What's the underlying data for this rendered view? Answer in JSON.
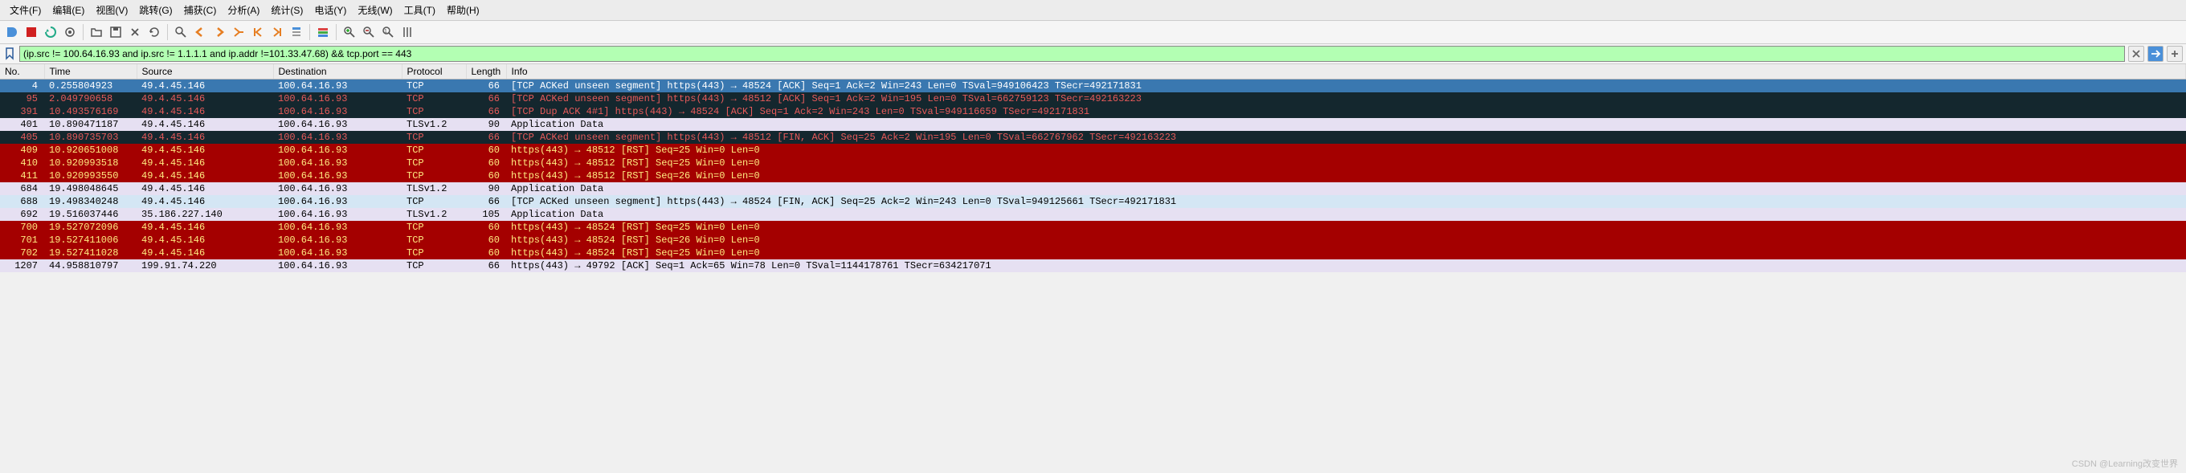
{
  "menu": {
    "file": "文件(F)",
    "edit": "编辑(E)",
    "view": "视图(V)",
    "go": "跳转(G)",
    "capture": "捕获(C)",
    "analyze": "分析(A)",
    "statistics": "统计(S)",
    "telephony": "电话(Y)",
    "wireless": "无线(W)",
    "tools": "工具(T)",
    "help": "帮助(H)"
  },
  "filter": {
    "value": "(ip.src != 100.64.16.93 and ip.src != 1.1.1.1 and ip.addr !=101.33.47.68) && tcp.port == 443"
  },
  "headers": {
    "no": "No.",
    "time": "Time",
    "src": "Source",
    "dst": "Destination",
    "proto": "Protocol",
    "len": "Length",
    "info": "Info"
  },
  "packets": [
    {
      "no": "4",
      "time": "0.255804923",
      "src": "49.4.45.146",
      "dst": "100.64.16.93",
      "proto": "TCP",
      "len": "66",
      "info": "[TCP ACKed unseen segment] https(443) → 48524 [ACK] Seq=1 Ack=2 Win=243 Len=0 TSval=949106423 TSecr=492171831",
      "cls": "row-selected"
    },
    {
      "no": "95",
      "time": "2.049790658",
      "src": "49.4.45.146",
      "dst": "100.64.16.93",
      "proto": "TCP",
      "len": "66",
      "info": "[TCP ACKed unseen segment] https(443) → 48512 [ACK] Seq=1 Ack=2 Win=195 Len=0 TSval=662759123 TSecr=492163223",
      "cls": "row-black"
    },
    {
      "no": "391",
      "time": "10.493576169",
      "src": "49.4.45.146",
      "dst": "100.64.16.93",
      "proto": "TCP",
      "len": "66",
      "info": "[TCP Dup ACK 4#1] https(443) → 48524 [ACK] Seq=1 Ack=2 Win=243 Len=0 TSval=949116659 TSecr=492171831",
      "cls": "row-black"
    },
    {
      "no": "401",
      "time": "10.890471187",
      "src": "49.4.45.146",
      "dst": "100.64.16.93",
      "proto": "TLSv1.2",
      "len": "90",
      "info": "Application Data",
      "cls": "row-lavender"
    },
    {
      "no": "405",
      "time": "10.890735703",
      "src": "49.4.45.146",
      "dst": "100.64.16.93",
      "proto": "TCP",
      "len": "66",
      "info": "[TCP ACKed unseen segment] https(443) → 48512 [FIN, ACK] Seq=25 Ack=2 Win=195 Len=0 TSval=662767962 TSecr=492163223",
      "cls": "row-black"
    },
    {
      "no": "409",
      "time": "10.920651008",
      "src": "49.4.45.146",
      "dst": "100.64.16.93",
      "proto": "TCP",
      "len": "60",
      "info": "https(443) → 48512 [RST] Seq=25 Win=0 Len=0",
      "cls": "row-red"
    },
    {
      "no": "410",
      "time": "10.920993518",
      "src": "49.4.45.146",
      "dst": "100.64.16.93",
      "proto": "TCP",
      "len": "60",
      "info": "https(443) → 48512 [RST] Seq=25 Win=0 Len=0",
      "cls": "row-red"
    },
    {
      "no": "411",
      "time": "10.920993550",
      "src": "49.4.45.146",
      "dst": "100.64.16.93",
      "proto": "TCP",
      "len": "60",
      "info": "https(443) → 48512 [RST] Seq=26 Win=0 Len=0",
      "cls": "row-red"
    },
    {
      "no": "684",
      "time": "19.498048645",
      "src": "49.4.45.146",
      "dst": "100.64.16.93",
      "proto": "TLSv1.2",
      "len": "90",
      "info": "Application Data",
      "cls": "row-lavender"
    },
    {
      "no": "688",
      "time": "19.498340248",
      "src": "49.4.45.146",
      "dst": "100.64.16.93",
      "proto": "TCP",
      "len": "66",
      "info": "[TCP ACKed unseen segment] https(443) → 48524 [FIN, ACK] Seq=25 Ack=2 Win=243 Len=0 TSval=949125661 TSecr=492171831",
      "cls": "row-blue"
    },
    {
      "no": "692",
      "time": "19.516037446",
      "src": "35.186.227.140",
      "dst": "100.64.16.93",
      "proto": "TLSv1.2",
      "len": "105",
      "info": "Application Data",
      "cls": "row-lavender"
    },
    {
      "no": "700",
      "time": "19.527072096",
      "src": "49.4.45.146",
      "dst": "100.64.16.93",
      "proto": "TCP",
      "len": "60",
      "info": "https(443) → 48524 [RST] Seq=25 Win=0 Len=0",
      "cls": "row-red"
    },
    {
      "no": "701",
      "time": "19.527411006",
      "src": "49.4.45.146",
      "dst": "100.64.16.93",
      "proto": "TCP",
      "len": "60",
      "info": "https(443) → 48524 [RST] Seq=26 Win=0 Len=0",
      "cls": "row-red"
    },
    {
      "no": "702",
      "time": "19.527411028",
      "src": "49.4.45.146",
      "dst": "100.64.16.93",
      "proto": "TCP",
      "len": "60",
      "info": "https(443) → 48524 [RST] Seq=25 Win=0 Len=0",
      "cls": "row-red"
    },
    {
      "no": "1207",
      "time": "44.958810797",
      "src": "199.91.74.220",
      "dst": "100.64.16.93",
      "proto": "TCP",
      "len": "66",
      "info": "https(443) → 49792 [ACK] Seq=1 Ack=65 Win=78 Len=0 TSval=1144178761 TSecr=634217071",
      "cls": "row-lavender"
    }
  ],
  "watermark": "CSDN @Learning改变世界"
}
